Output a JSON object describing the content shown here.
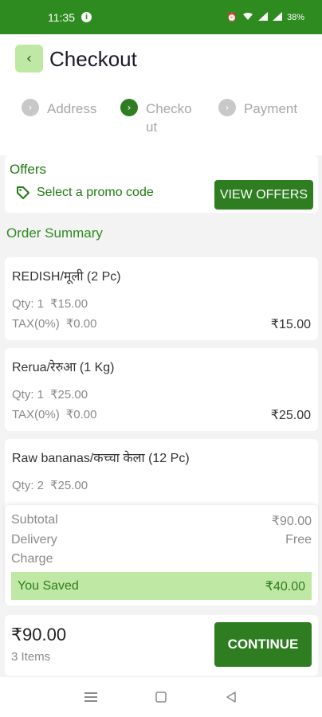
{
  "status_bar": {
    "time": "11:35",
    "battery": "38%",
    "icons": [
      "info-icon",
      "alarm-icon",
      "data-saver-icon",
      "wifi-icon",
      "volte-icon",
      "signal-icon",
      "signal-icon",
      "battery-icon"
    ]
  },
  "header": {
    "back_icon": "chevron-left-icon",
    "title": "Checkout"
  },
  "stepper": [
    {
      "label": "Address",
      "active": false
    },
    {
      "label": "Checkout",
      "active": true
    },
    {
      "label": "Payment",
      "active": false
    }
  ],
  "offers": {
    "title": "Offers",
    "promo_text": "Select a promo code",
    "button": "VIEW OFFERS"
  },
  "order_summary_title": "Order Summary",
  "items": [
    {
      "name": "REDISH/मूली (2 Pc)",
      "qty": "Qty: 1",
      "price": "₹15.00",
      "tax": "TAX(0%)",
      "tax_amount": "₹0.00",
      "total": "₹15.00"
    },
    {
      "name": "Rerua/रेरुआ (1 Kg)",
      "qty": "Qty: 1",
      "price": "₹25.00",
      "tax": "TAX(0%)",
      "tax_amount": "₹0.00",
      "total": "₹25.00"
    },
    {
      "name": "Raw bananas/कच्चा केला (12 Pc)",
      "qty": "Qty: 2",
      "price": "₹25.00"
    }
  ],
  "totals": {
    "subtotal_label": "Subtotal",
    "subtotal_value": "₹90.00",
    "delivery_label_1": "Delivery",
    "delivery_label_2": "Charge",
    "delivery_value": "Free",
    "saved_label": "You Saved",
    "saved_value": "₹40.00"
  },
  "bottom": {
    "grand_total": "₹90.00",
    "item_count": "3 Items",
    "continue": "CONTINUE"
  },
  "colors": {
    "brand_green": "#2e7d20",
    "light_green": "#bfe8a4",
    "status_bar": "#2e8b1f"
  }
}
